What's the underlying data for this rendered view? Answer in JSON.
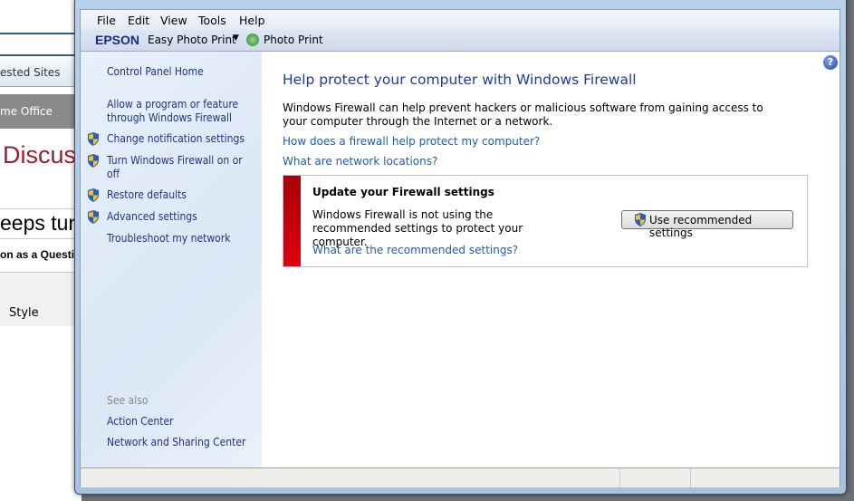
{
  "background": {
    "address_tab": "ested Sites",
    "office": "me Office",
    "discuss": "Discus",
    "heading": "eeps tur",
    "question": "on as a Questi",
    "style": "Style"
  },
  "menu": {
    "items": [
      "File",
      "Edit",
      "View",
      "Tools",
      "Help"
    ]
  },
  "toolbar": {
    "brand": "EPSON",
    "easy_photo_print": "Easy Photo Print",
    "photo_print": "Photo Print"
  },
  "sidebar": {
    "home": "Control Panel Home",
    "items": [
      {
        "label": "Allow a program or feature through Windows Firewall",
        "shield": false
      },
      {
        "label": "Change notification settings",
        "shield": true
      },
      {
        "label": "Turn Windows Firewall on or off",
        "shield": true
      },
      {
        "label": "Restore defaults",
        "shield": true
      },
      {
        "label": "Advanced settings",
        "shield": true
      },
      {
        "label": "Troubleshoot my network",
        "shield": false
      }
    ],
    "see_also": "See also",
    "see_also_links": [
      "Action Center",
      "Network and Sharing Center"
    ]
  },
  "main": {
    "title": "Help protect your computer with Windows Firewall",
    "description": "Windows Firewall can help prevent hackers or malicious software from gaining access to your computer through the Internet or a network.",
    "links": [
      "How does a firewall help protect my computer?",
      "What are network locations?"
    ],
    "alert": {
      "title": "Update your Firewall settings",
      "text": "Windows Firewall is not using the recommended settings to protect your computer.",
      "link": "What are the recommended settings?",
      "button": "Use recommended settings",
      "color": "#c8000a"
    }
  },
  "colors": {
    "link": "#1e5bb4",
    "title": "#1e3c96",
    "sidebar_text": "#1e3287"
  }
}
